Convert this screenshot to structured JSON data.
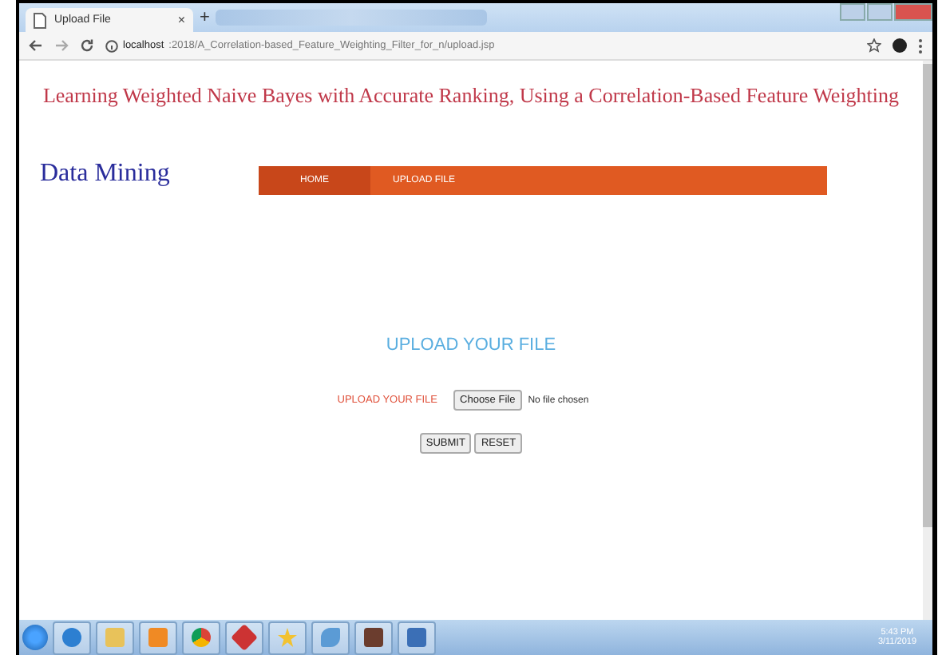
{
  "browser": {
    "tab_title": "Upload File",
    "tab_close": "×",
    "new_tab": "+",
    "url_host": "localhost",
    "url_path": ":2018/A_Correlation-based_Feature_Weighting_Filter_for_n/upload.jsp"
  },
  "page": {
    "title": "Learning Weighted Naive Bayes with Accurate Ranking, Using a Correlation-Based Feature Weighting",
    "logo": "Data Mining",
    "nav": [
      {
        "label": "HOME",
        "selected": true
      },
      {
        "label": "UPLOAD FILE",
        "selected": false
      }
    ],
    "heading": "UPLOAD YOUR FILE",
    "field_label": "UPLOAD YOUR FILE",
    "choose_button": "Choose File",
    "file_status": "No file chosen",
    "buttons": [
      "SUBMIT",
      "RESET"
    ]
  },
  "taskbar": {
    "time": "5:43 PM",
    "date": "3/11/2019"
  }
}
